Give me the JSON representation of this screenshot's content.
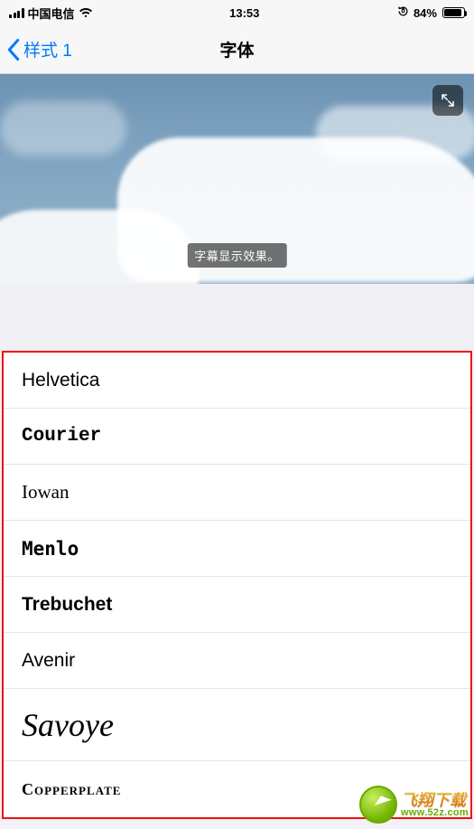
{
  "status": {
    "carrier": "中国电信",
    "time": "13:53",
    "battery_pct": "84%"
  },
  "nav": {
    "back_label": "样式 1",
    "title": "字体"
  },
  "preview": {
    "caption": "字幕显示效果。"
  },
  "fonts": [
    {
      "id": "helvetica",
      "label": "Helvetica",
      "css": "ff-helvetica"
    },
    {
      "id": "courier",
      "label": "Courier",
      "css": "ff-courier"
    },
    {
      "id": "iowan",
      "label": "Iowan",
      "css": "ff-iowan"
    },
    {
      "id": "menlo",
      "label": "Menlo",
      "css": "ff-menlo"
    },
    {
      "id": "trebuchet",
      "label": "Trebuchet",
      "css": "ff-trebuchet"
    },
    {
      "id": "avenir",
      "label": "Avenir",
      "css": "ff-avenir"
    },
    {
      "id": "savoye",
      "label": "Savoye",
      "css": "ff-savoye",
      "item_css": "savoye-item"
    },
    {
      "id": "copperplate",
      "label": "Copperplate",
      "css": "ff-copperplate"
    }
  ],
  "watermark": {
    "title": "飞翔下载",
    "url": "www.52z.com"
  }
}
